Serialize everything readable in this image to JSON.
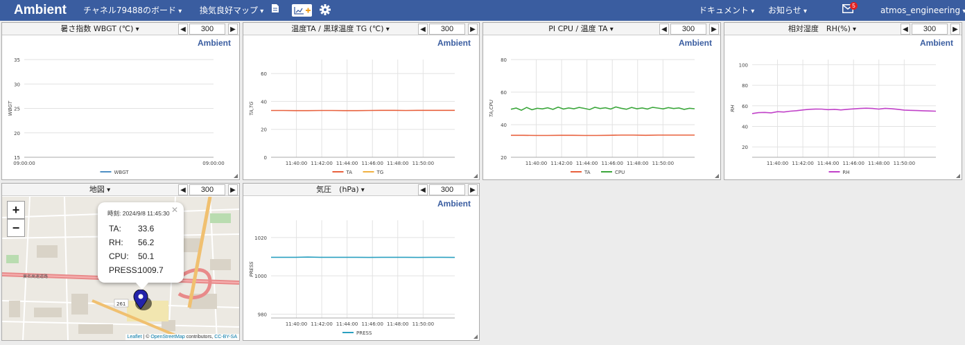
{
  "navbar": {
    "brand": "Ambient",
    "board": "チャネル79488のボード",
    "map_menu": "換気良好マップ",
    "docs": "ドキュメント",
    "news": "お知らせ",
    "notification_count": "5",
    "user": "atmos_engineering"
  },
  "colors": {
    "navbar": "#3a5da0",
    "accent": "#3a5da0"
  },
  "panels": {
    "wbgt": {
      "title": "暑さ指数 WBGT (℃)",
      "range": "300",
      "logo": "Ambient"
    },
    "temp": {
      "title": "温度TA / 黒球温度 TG (℃)",
      "range": "300",
      "logo": "Ambient"
    },
    "cpu": {
      "title": "PI CPU / 温度 TA",
      "range": "300",
      "logo": "Ambient"
    },
    "rh": {
      "title": "相対湿度　RH(%)",
      "range": "300",
      "logo": "Ambient"
    },
    "map": {
      "title": "地図",
      "range": "300"
    },
    "press": {
      "title": "気圧　(hPa)",
      "range": "300",
      "logo": "Ambient"
    }
  },
  "map": {
    "zoom_in": "+",
    "zoom_out": "−",
    "popup": {
      "time": "時刻: 2024/9/8 11:45:30",
      "rows": [
        {
          "key": "TA:",
          "value": "33.6"
        },
        {
          "key": "RH:",
          "value": "56.2"
        },
        {
          "key": "CPU:",
          "value": "50.1"
        },
        {
          "key": "PRESS:",
          "value": "1009.7"
        }
      ]
    },
    "labels": {
      "expressway": "東名高速道路",
      "route": "261"
    },
    "attribution": {
      "leaflet": "Leaflet",
      "sep": " | © ",
      "osm": "OpenStreetMap",
      "contrib": " contributors, ",
      "license": "CC-BY-SA"
    }
  },
  "chart_data": [
    {
      "id": "wbgt",
      "type": "line",
      "ylabel": "WBGT",
      "ylim": [
        15,
        35
      ],
      "yticks": [
        15,
        20,
        25,
        30,
        35
      ],
      "xticks": [
        "09:00:00",
        "09:00:00"
      ],
      "grid": true,
      "legend": "bottom",
      "series": [
        {
          "name": "WBGT",
          "color": "#4e8fc4",
          "values": []
        }
      ]
    },
    {
      "id": "temp",
      "type": "line",
      "ylabel": "TA,TG",
      "ylim": [
        0,
        70
      ],
      "yticks": [
        0,
        20,
        40,
        60
      ],
      "x": [
        "11:38:00",
        "11:52:30"
      ],
      "xticks": [
        "11:40:00",
        "11:42:00",
        "11:44:00",
        "11:46:00",
        "11:48:00",
        "11:50:00"
      ],
      "grid": true,
      "legend": "bottom",
      "series": [
        {
          "name": "TA",
          "color": "#e8603c",
          "values": [
            33.5,
            33.5,
            33.4,
            33.4,
            33.5,
            33.5,
            33.4,
            33.4,
            33.5,
            33.6,
            33.6,
            33.5,
            33.6,
            33.6,
            33.6,
            33.6
          ]
        },
        {
          "name": "TG",
          "color": "#f0b040",
          "values": []
        }
      ]
    },
    {
      "id": "cpu",
      "type": "line",
      "ylabel": "TA,CPU",
      "ylim": [
        20,
        80
      ],
      "yticks": [
        20,
        40,
        60,
        80
      ],
      "x": [
        "11:38:00",
        "11:52:30"
      ],
      "xticks": [
        "11:40:00",
        "11:42:00",
        "11:44:00",
        "11:46:00",
        "11:48:00",
        "11:50:00"
      ],
      "grid": true,
      "legend": "bottom",
      "series": [
        {
          "name": "TA",
          "color": "#e8603c",
          "values": [
            33.5,
            33.5,
            33.4,
            33.4,
            33.5,
            33.5,
            33.4,
            33.4,
            33.5,
            33.6,
            33.6,
            33.5,
            33.6,
            33.6,
            33.6,
            33.6
          ]
        },
        {
          "name": "CPU",
          "color": "#3aa63a",
          "values": [
            49.5,
            50.2,
            48.9,
            50.6,
            49.2,
            50.1,
            49.7,
            50.4,
            49.4,
            50.8,
            49.6,
            50.3,
            49.8,
            50.6,
            50.0,
            49.3,
            50.7,
            49.9,
            50.4,
            49.6,
            50.9,
            50.1,
            49.5,
            50.6,
            49.8,
            50.3,
            49.6,
            50.7,
            50.2,
            49.7,
            50.5,
            49.9,
            50.3,
            49.4,
            50.1,
            49.8
          ]
        }
      ]
    },
    {
      "id": "rh",
      "type": "line",
      "ylabel": "RH",
      "ylim": [
        10,
        105
      ],
      "yticks": [
        20,
        40,
        60,
        80,
        100
      ],
      "x": [
        "11:38:00",
        "11:52:30"
      ],
      "xticks": [
        "11:40:00",
        "11:42:00",
        "11:44:00",
        "11:46:00",
        "11:48:00",
        "11:50:00"
      ],
      "grid": true,
      "legend": "bottom",
      "series": [
        {
          "name": "RH",
          "color": "#c040c8",
          "values": [
            52.5,
            53.4,
            53.6,
            53.2,
            54.3,
            54.0,
            54.8,
            55.3,
            56.0,
            56.6,
            56.9,
            56.8,
            56.3,
            56.6,
            56.0,
            56.6,
            57.0,
            57.4,
            57.7,
            57.4,
            56.8,
            57.6,
            57.2,
            56.6,
            55.9,
            55.6,
            55.4,
            55.2,
            55.0,
            54.8
          ]
        }
      ]
    },
    {
      "id": "press",
      "type": "line",
      "ylabel": "PRESS",
      "ylim": [
        978,
        1029
      ],
      "yticks": [
        980,
        1000,
        1020
      ],
      "x": [
        "11:38:00",
        "11:52:30"
      ],
      "xticks": [
        "11:40:00",
        "11:42:00",
        "11:44:00",
        "11:46:00",
        "11:48:00",
        "11:50:00"
      ],
      "grid": true,
      "legend": "bottom",
      "series": [
        {
          "name": "PRESS",
          "color": "#2aa0c0",
          "values": [
            1009.7,
            1009.7,
            1009.7,
            1009.8,
            1009.7,
            1009.7,
            1009.7,
            1009.7,
            1009.6,
            1009.7,
            1009.7,
            1009.7,
            1009.6,
            1009.7,
            1009.7,
            1009.6
          ]
        }
      ]
    }
  ]
}
